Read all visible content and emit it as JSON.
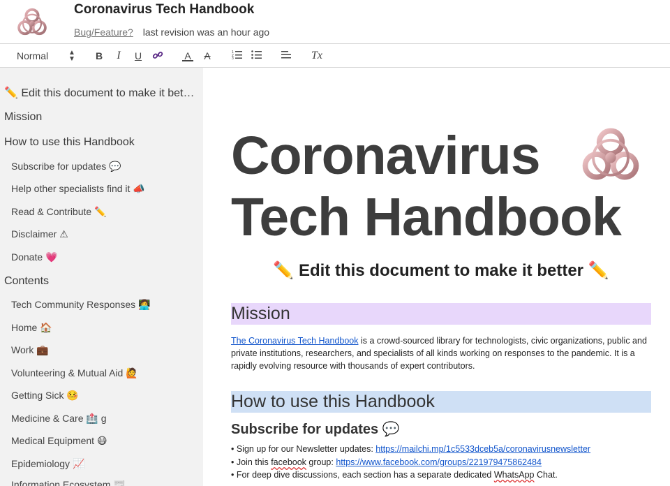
{
  "header": {
    "title": "Coronavirus Tech Handbook",
    "bug_link": "Bug/Feature?",
    "revision": "last revision was an hour ago",
    "logo_icon": "biohazard-icon"
  },
  "toolbar": {
    "style_select": "Normal",
    "bold": "B",
    "italic": "I",
    "underline": "U",
    "link_icon": "link-icon",
    "text_color": "A",
    "highlight": "A",
    "ordered_list_icon": "ordered-list-icon",
    "bullet_list_icon": "bullet-list-icon",
    "align_icon": "align-left-icon",
    "clear_format": "Tx"
  },
  "sidebar": {
    "items": [
      {
        "label": "✏️ Edit this document to make it better ✏️",
        "level": "h"
      },
      {
        "label": "Mission",
        "level": "h"
      },
      {
        "label": "How to use this Handbook",
        "level": "h"
      },
      {
        "label": "Subscribe for updates 💬",
        "level": "s"
      },
      {
        "label": "Help other specialists find it 📣",
        "level": "s"
      },
      {
        "label": "Read & Contribute ✏️",
        "level": "s"
      },
      {
        "label": "Disclaimer ⚠",
        "level": "s"
      },
      {
        "label": "Donate 💗",
        "level": "s"
      },
      {
        "label": "Contents",
        "level": "h"
      },
      {
        "label": "Tech Community Responses 👩‍💻",
        "level": "s"
      },
      {
        "label": "Home 🏠",
        "level": "s"
      },
      {
        "label": "Work 💼",
        "level": "s"
      },
      {
        "label": "Volunteering & Mutual Aid 🙋",
        "level": "s"
      },
      {
        "label": "Getting Sick 🤒",
        "level": "s"
      },
      {
        "label": "Medicine & Care 🏥 g",
        "level": "s"
      },
      {
        "label": "Medical Equipment 😷",
        "level": "s"
      },
      {
        "label": "Epidemiology 📈",
        "level": "s"
      },
      {
        "label": "Information Ecosystem 📰",
        "level": "s"
      }
    ]
  },
  "doc": {
    "title_line1": "Coronavirus",
    "title_line2": "Tech Handbook",
    "edit_heading": "✏️ Edit this document to make it better ✏️",
    "mission_heading": "Mission",
    "mission_link": "The Coronavirus Tech Handbook",
    "mission_text": " is a crowd-sourced library for technologists, civic organizations, public and private institutions, researchers, and specialists of all kinds working on responses to the pandemic. It is a rapidly evolving resource with thousands of expert contributors.",
    "howto_heading": "How to use this Handbook",
    "subscribe_heading": "Subscribe for updates 💬",
    "bullet1_text": "• Sign up for our Newsletter updates: ",
    "bullet1_link": "https://mailchi.mp/1c5533dceb5a/coronavirusnewsletter",
    "bullet2_pre": "• Join this ",
    "bullet2_mid": "facebook",
    "bullet2_post": " group: ",
    "bullet2_link": "https://www.facebook.com/groups/221979475862484",
    "bullet3_pre": "• For deep dive discussions, each section has a separate dedicated ",
    "bullet3_mid": "WhatsApp",
    "bullet3_post": " Chat."
  },
  "colors": {
    "mission_band": "#e8d7fb",
    "howto_band": "#cfe0f5",
    "link": "#1155cc",
    "sidebar_bg": "#f2f2f2"
  }
}
